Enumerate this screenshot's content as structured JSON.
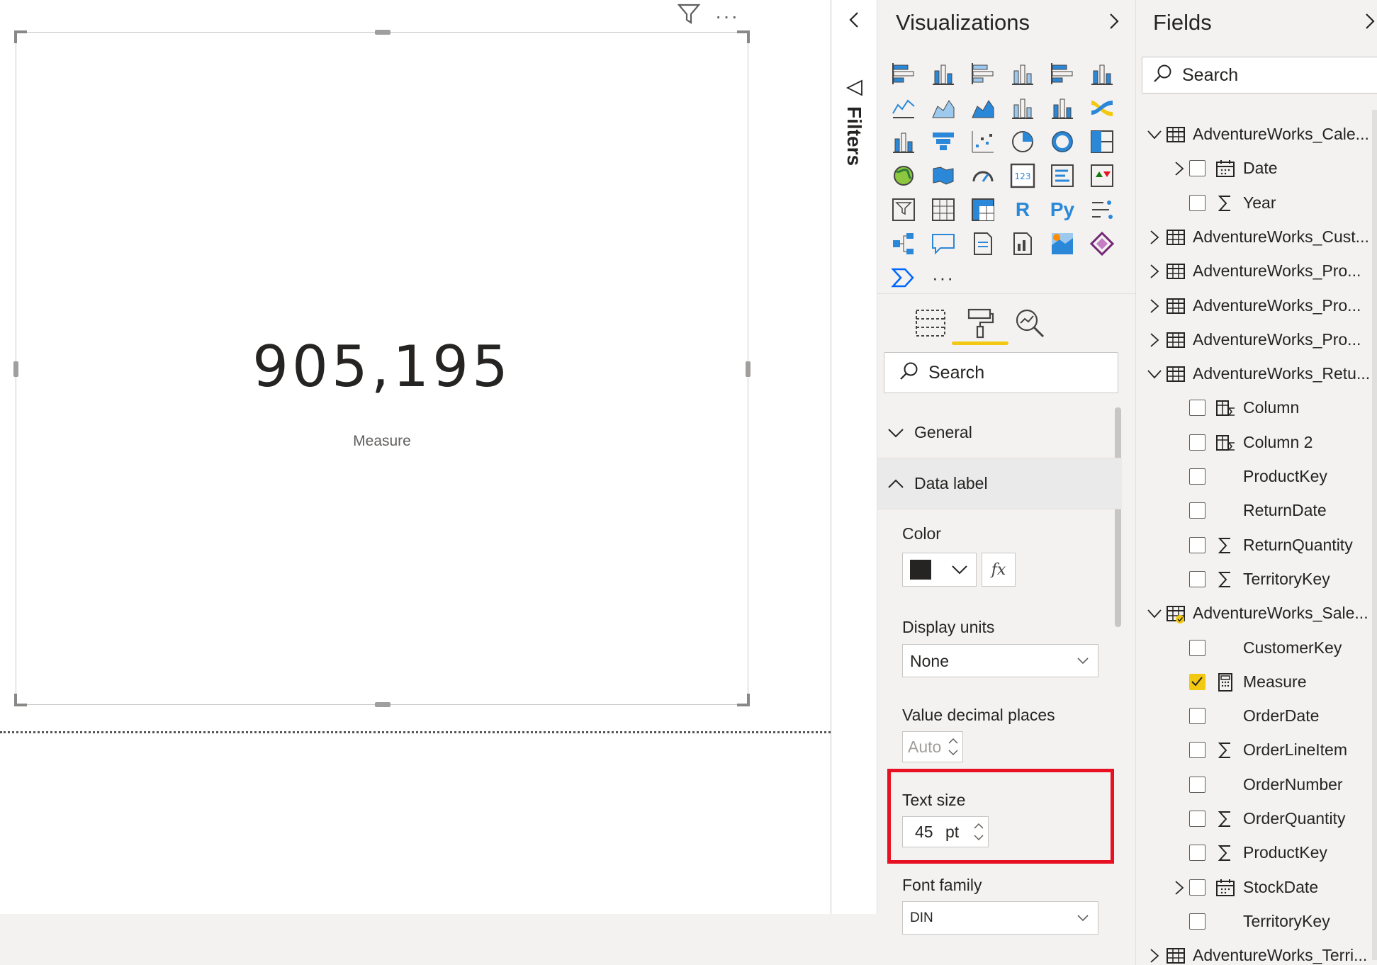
{
  "card_visual": {
    "value": "905,195",
    "label": "Measure"
  },
  "filters_pane": {
    "label": "Filters"
  },
  "visualizations_pane": {
    "title": "Visualizations",
    "search_placeholder": "Search",
    "sections": [
      {
        "label": "General",
        "expanded": false
      },
      {
        "label": "Data label",
        "expanded": true
      }
    ],
    "properties": {
      "color_label": "Color",
      "color_value": "#252423",
      "fx_label": "fx",
      "display_units_label": "Display units",
      "display_units_value": "None",
      "decimal_places_label": "Value decimal places",
      "decimal_places_value": "Auto",
      "text_size_label": "Text size",
      "text_size_value": "45",
      "text_size_unit": "pt",
      "font_family_label": "Font family",
      "font_family_value": "DIN"
    },
    "icons": [
      "stacked-bar-chart-icon",
      "stacked-column-chart-icon",
      "clustered-bar-chart-icon",
      "clustered-column-chart-icon",
      "100-stacked-bar-chart-icon",
      "100-stacked-column-chart-icon",
      "line-chart-icon",
      "area-chart-icon",
      "stacked-area-chart-icon",
      "line-and-column-chart-icon",
      "line-and-clustered-column-chart-icon",
      "ribbon-chart-icon",
      "waterfall-chart-icon",
      "funnel-chart-icon",
      "scatter-chart-icon",
      "pie-chart-icon",
      "donut-chart-icon",
      "treemap-icon",
      "map-icon",
      "filled-map-icon",
      "gauge-icon",
      "card-icon",
      "multi-row-card-icon",
      "kpi-icon",
      "slicer-icon",
      "table-icon",
      "matrix-icon",
      "r-script-visual-icon",
      "python-visual-icon",
      "key-influencers-icon",
      "decomposition-tree-icon",
      "qa-icon",
      "smart-narrative-icon",
      "paginated-report-icon",
      "arcgis-map-icon",
      "power-apps-icon",
      "power-automate-icon",
      "more-visuals-icon"
    ],
    "r_glyph": "R",
    "py_glyph": "Py",
    "more_glyph": "···"
  },
  "fields_pane": {
    "title": "Fields",
    "search_placeholder": "Search",
    "items": [
      {
        "text": "AdventureWorks_Cale...",
        "level": 0,
        "kind": "table",
        "expander": "expanded"
      },
      {
        "text": "Date",
        "level": 1,
        "kind": "calendar",
        "expander": "collapsed",
        "checked": false
      },
      {
        "text": "Year",
        "level": 1,
        "kind": "sigma",
        "expander": "none",
        "checked": false
      },
      {
        "text": "AdventureWorks_Cust...",
        "level": 0,
        "kind": "table",
        "expander": "collapsed"
      },
      {
        "text": "AdventureWorks_Pro...",
        "level": 0,
        "kind": "table",
        "expander": "collapsed"
      },
      {
        "text": "AdventureWorks_Pro...",
        "level": 0,
        "kind": "table",
        "expander": "collapsed"
      },
      {
        "text": "AdventureWorks_Pro...",
        "level": 0,
        "kind": "table",
        "expander": "collapsed"
      },
      {
        "text": "AdventureWorks_Retu...",
        "level": 0,
        "kind": "table",
        "expander": "expanded"
      },
      {
        "text": "Column",
        "level": 1,
        "kind": "calc-column",
        "expander": "none",
        "checked": false
      },
      {
        "text": "Column 2",
        "level": 1,
        "kind": "calc-column",
        "expander": "none",
        "checked": false
      },
      {
        "text": "ProductKey",
        "level": 1,
        "kind": "none",
        "expander": "none",
        "checked": false
      },
      {
        "text": "ReturnDate",
        "level": 1,
        "kind": "none",
        "expander": "none",
        "checked": false
      },
      {
        "text": "ReturnQuantity",
        "level": 1,
        "kind": "sigma",
        "expander": "none",
        "checked": false
      },
      {
        "text": "TerritoryKey",
        "level": 1,
        "kind": "sigma",
        "expander": "none",
        "checked": false
      },
      {
        "text": "AdventureWorks_Sale...",
        "level": 0,
        "kind": "table-active",
        "expander": "expanded"
      },
      {
        "text": "CustomerKey",
        "level": 1,
        "kind": "none",
        "expander": "none",
        "checked": false
      },
      {
        "text": "Measure",
        "level": 1,
        "kind": "calculator",
        "expander": "none",
        "checked": true
      },
      {
        "text": "OrderDate",
        "level": 1,
        "kind": "none",
        "expander": "none",
        "checked": false
      },
      {
        "text": "OrderLineItem",
        "level": 1,
        "kind": "sigma",
        "expander": "none",
        "checked": false
      },
      {
        "text": "OrderNumber",
        "level": 1,
        "kind": "none",
        "expander": "none",
        "checked": false
      },
      {
        "text": "OrderQuantity",
        "level": 1,
        "kind": "sigma",
        "expander": "none",
        "checked": false
      },
      {
        "text": "ProductKey",
        "level": 1,
        "kind": "sigma",
        "expander": "none",
        "checked": false
      },
      {
        "text": "StockDate",
        "level": 1,
        "kind": "calendar",
        "expander": "collapsed",
        "checked": false
      },
      {
        "text": "TerritoryKey",
        "level": 1,
        "kind": "none",
        "expander": "none",
        "checked": false
      },
      {
        "text": "AdventureWorks_Terri...",
        "level": 0,
        "kind": "table",
        "expander": "collapsed"
      }
    ]
  },
  "colors": {
    "accent_yellow": "#f2c811",
    "highlight_red": "#e81123",
    "icon_blue": "#2b88d8"
  }
}
